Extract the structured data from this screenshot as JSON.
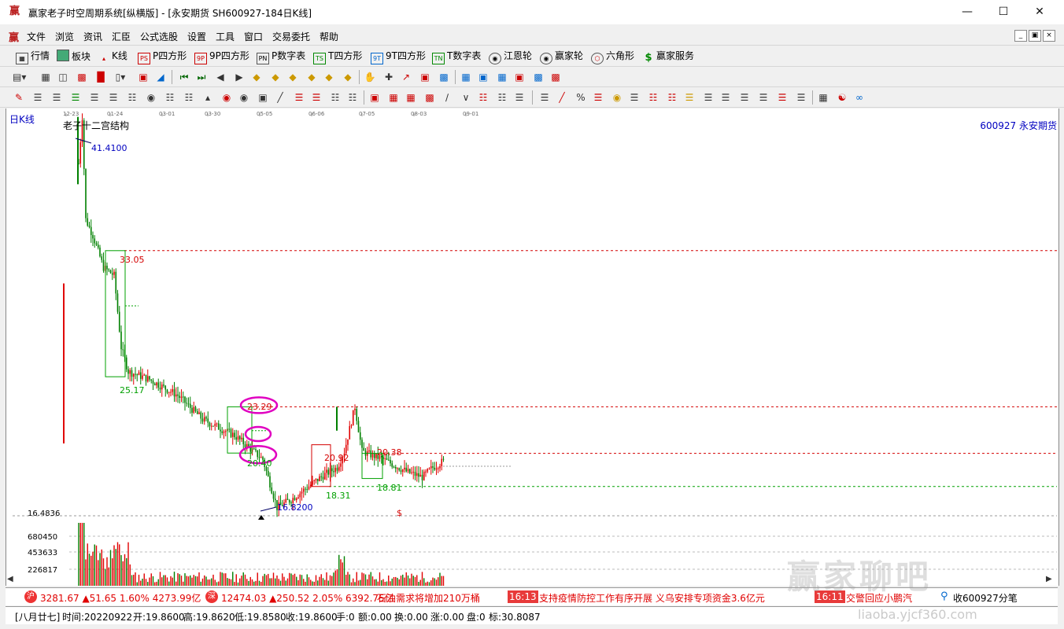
{
  "window": {
    "title": "赢家老子时空周期系统[纵横版] - [永安期货  SH600927-184日K线]",
    "app_icon": "赢"
  },
  "menu": [
    "文件",
    "浏览",
    "资讯",
    "汇臣",
    "公式选股",
    "设置",
    "工具",
    "窗口",
    "交易委托",
    "帮助"
  ],
  "toolbar1": [
    {
      "label": "行情",
      "icon": "grid-icon"
    },
    {
      "label": "板块",
      "icon": "blocks-icon"
    },
    {
      "label": "K线",
      "icon": "kline-icon"
    },
    {
      "label": "P四方形",
      "icon": "p-square-icon"
    },
    {
      "label": "9P四方形",
      "icon": "9p-square-icon"
    },
    {
      "label": "P数字表",
      "icon": "p-table-icon"
    },
    {
      "label": "T四方形",
      "icon": "t-square-icon"
    },
    {
      "label": "9T四方形",
      "icon": "9t-square-icon"
    },
    {
      "label": "T数字表",
      "icon": "t-table-icon"
    },
    {
      "label": "江恩轮",
      "icon": "gann-wheel-icon"
    },
    {
      "label": "赢家轮",
      "icon": "winner-wheel-icon"
    },
    {
      "label": "六角形",
      "icon": "hexagon-icon"
    },
    {
      "label": "赢家服务",
      "icon": "dollar-icon"
    }
  ],
  "chart": {
    "period_label": "日K线",
    "indicator_title": "老子十二宫结构",
    "stock": "600927  永安期货",
    "date_ticks": [
      "12-23",
      "01-24",
      "03-01",
      "03-30",
      "05-05",
      "06-06",
      "07-05",
      "08-03",
      "09-01"
    ],
    "price_labels": {
      "high": "41.4100",
      "low": "16.8200",
      "level_33": "33.05",
      "level_25": "25.17",
      "level_23": "23.29",
      "level_2040": "20.40",
      "level_2092": "20.92",
      "level_2038": "20.38",
      "level_1831": "18.31",
      "level_1881": "18.81",
      "dollar": "$"
    },
    "volume_axis": [
      "16.4836",
      "680450",
      "453633",
      "226817"
    ],
    "colors": {
      "up": "#e00000",
      "down": "#008000",
      "level_red": "#d40000",
      "level_green": "#00a000",
      "highlight": "#e000c0"
    }
  },
  "status1": {
    "sh_index": "3281.67 ▲51.65 1.60% 4273.99亿",
    "sz_index": "12474.03 ▲250.52 2.05% 6392.75亿",
    "news1": "石油需求将增加210万桶",
    "time1": "16:13",
    "news2": "支持疫情防控工作有序开展 义乌安排专项资金3.6亿元",
    "time2": "16:11",
    "news3": "交警回应小鹏汽",
    "tail": "收600927分笔"
  },
  "status2": {
    "lunar": "[八月廿七]",
    "time": "时间:20220922",
    "open": "开:19.8600",
    "high": "高:19.8620",
    "low": "低:19.8580",
    "close": "收:19.8600",
    "hand": "手:0",
    "amount": "额:0.00",
    "turnover": "换:0.00",
    "change": "涨:0.00",
    "pan": "盘:0",
    "mark": "标:30.8087"
  },
  "watermark": {
    "main": "赢家聊吧",
    "url": "liaoba.yjcf360.com"
  }
}
